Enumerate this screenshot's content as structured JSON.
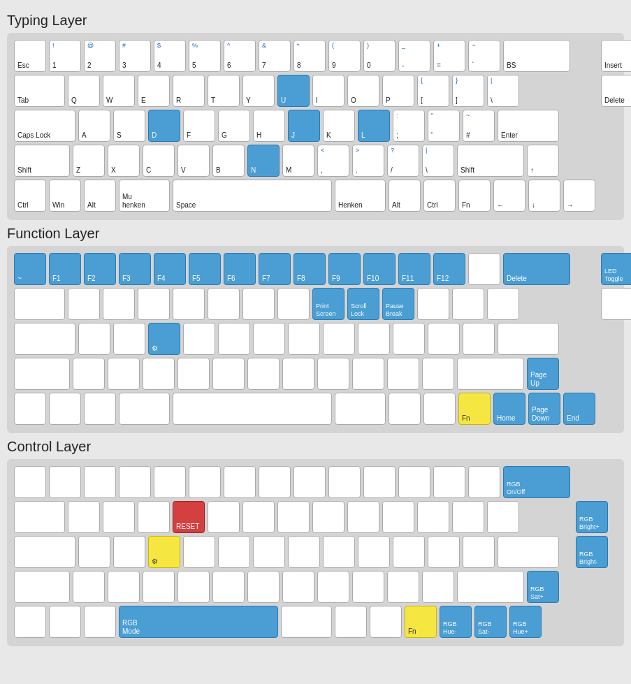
{
  "sections": [
    {
      "title": "Typing Layer",
      "id": "typing"
    },
    {
      "title": "Function Layer",
      "id": "function"
    },
    {
      "title": "Control Layer",
      "id": "control"
    }
  ]
}
